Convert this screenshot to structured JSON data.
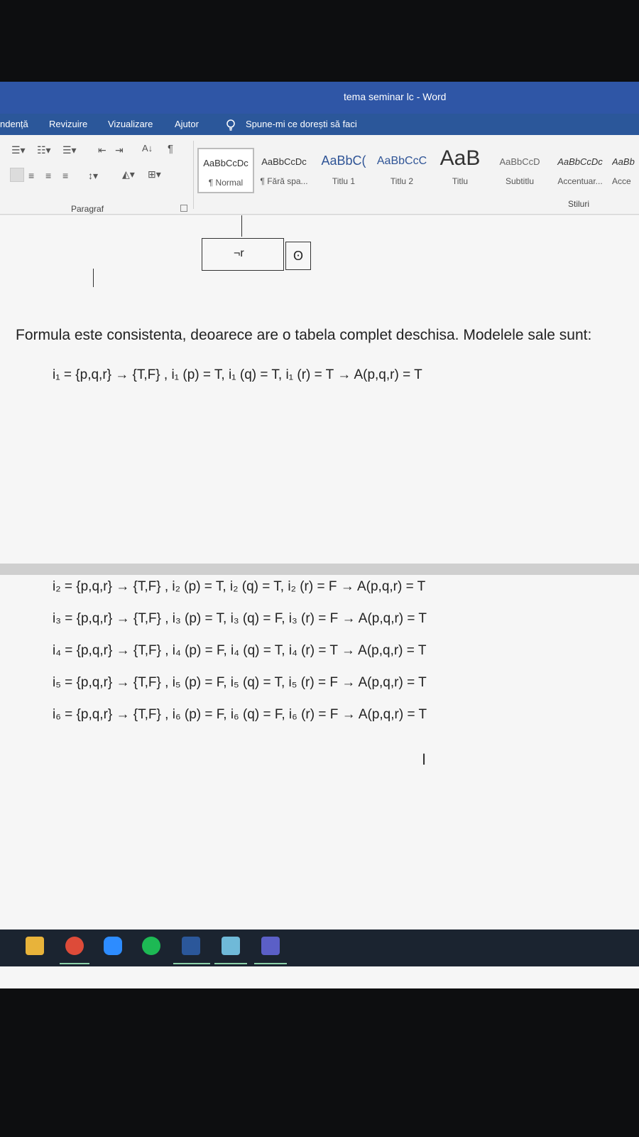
{
  "window": {
    "title": "tema seminar lc  -  Word"
  },
  "ribbon_tabs": [
    {
      "label": "ndență"
    },
    {
      "label": "Revizuire"
    },
    {
      "label": "Vizualizare"
    },
    {
      "label": "Ajutor"
    }
  ],
  "tell_me": {
    "label": "Spune-mi ce dorești să faci"
  },
  "paragraph_group": {
    "label": "Paragraf"
  },
  "styles": {
    "label": "Stiluri",
    "items": [
      {
        "sample": "AaBbCcDc",
        "name": "¶ Normal"
      },
      {
        "sample": "AaBbCcDc",
        "name": "¶ Fără spa..."
      },
      {
        "sample": "AaBbC(",
        "name": "Titlu 1"
      },
      {
        "sample": "AaBbCcC",
        "name": "Titlu 2"
      },
      {
        "sample": "AaB",
        "name": "Titlu"
      },
      {
        "sample": "AaBbCcD",
        "name": "Subtitlu"
      },
      {
        "sample": "AaBbCcDc",
        "name": "Accentuar..."
      },
      {
        "sample": "AaBb",
        "name": "Acce"
      }
    ]
  },
  "document": {
    "tree_node_negation": "¬r",
    "tree_node_closed": "ʘ",
    "conclusion": "Formula este consistenta, deoarece are o tabela complet deschisa. Modelele sale sunt:",
    "models": [
      "i₁ = {p,q,r} → {T,F} , i₁ (p) = T, i₁ (q) = T, i₁ (r) = T → A(p,q,r) = T",
      "i₂ = {p,q,r} → {T,F} , i₂ (p) = T, i₂ (q) = T, i₂ (r) = F → A(p,q,r) = T",
      "i₃ = {p,q,r} → {T,F} , i₃ (p) = T, i₃ (q) = F, i₃ (r) = F → A(p,q,r) = T",
      "i₄ = {p,q,r} → {T,F} , i₄ (p) = F, i₄ (q) = T, i₄ (r) = T → A(p,q,r) = T",
      "i₅ = {p,q,r} → {T,F} , i₅ (p) = F, i₅ (q) = T, i₅ (r) = F → A(p,q,r) = T",
      "i₆ = {p,q,r} → {T,F} , i₆ (p) = F, i₆ (q) = F, i₆ (r) = F → A(p,q,r) = T"
    ]
  },
  "taskbar": {
    "apps": [
      {
        "icon": "file-explorer-icon",
        "color": "#e8b33a"
      },
      {
        "icon": "chrome-icon",
        "color": "#dd4b39"
      },
      {
        "icon": "zoom-icon",
        "color": "#2d8cff"
      },
      {
        "icon": "spotify-icon",
        "color": "#1db954"
      },
      {
        "icon": "word-icon",
        "color": "#2b579a"
      },
      {
        "icon": "notes-icon",
        "color": "#6fb9d8"
      },
      {
        "icon": "teams-icon",
        "color": "#5b5fc7"
      }
    ]
  },
  "colors": {
    "title_bar": "#2f56a6",
    "ribbon_tabs": "#2b579a",
    "page": "#f6f6f6"
  }
}
